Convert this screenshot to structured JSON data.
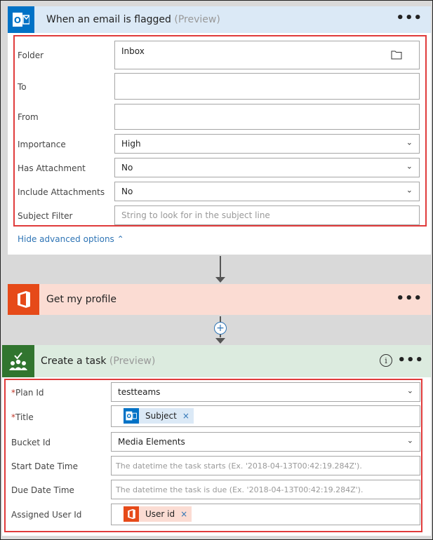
{
  "trigger": {
    "title": "When an email is flagged",
    "preview": "(Preview)",
    "more": "•••",
    "icon": "outlook-icon",
    "fields": {
      "folder": {
        "label": "Folder",
        "value": "Inbox"
      },
      "to": {
        "label": "To",
        "value": ""
      },
      "from": {
        "label": "From",
        "value": ""
      },
      "importance": {
        "label": "Importance",
        "value": "High"
      },
      "has_attachment": {
        "label": "Has Attachment",
        "value": "No"
      },
      "include_attachments": {
        "label": "Include Attachments",
        "value": "No"
      },
      "subject_filter": {
        "label": "Subject Filter",
        "placeholder": "String to look for in the subject line"
      }
    },
    "hide_advanced": "Hide advanced options"
  },
  "profile": {
    "title": "Get my profile",
    "more": "•••",
    "icon": "office-icon"
  },
  "task": {
    "title": "Create a task",
    "preview": "(Preview)",
    "more": "•••",
    "icon": "planner-icon",
    "fields": {
      "plan_id": {
        "label": "Plan Id",
        "required": "*",
        "value": "testteams"
      },
      "title": {
        "label": "Title",
        "required": "*",
        "token": "Subject"
      },
      "bucket_id": {
        "label": "Bucket Id",
        "value": "Media Elements"
      },
      "start_date": {
        "label": "Start Date Time",
        "placeholder": "The datetime the task starts (Ex. '2018-04-13T00:42:19.284Z')."
      },
      "due_date": {
        "label": "Due Date Time",
        "placeholder": "The datetime the task is due (Ex. '2018-04-13T00:42:19.284Z')."
      },
      "assigned_user": {
        "label": "Assigned User Id",
        "token": "User id"
      }
    }
  },
  "token_remove": "×",
  "colors": {
    "trigger_header": "#dbe9f6",
    "outlook_blue": "#0072c6",
    "profile_header": "#fbdcd3",
    "office_orange": "#e64a19",
    "task_header": "#dcebdf",
    "planner_green": "#31752f",
    "highlight_red": "#e03b3b"
  }
}
